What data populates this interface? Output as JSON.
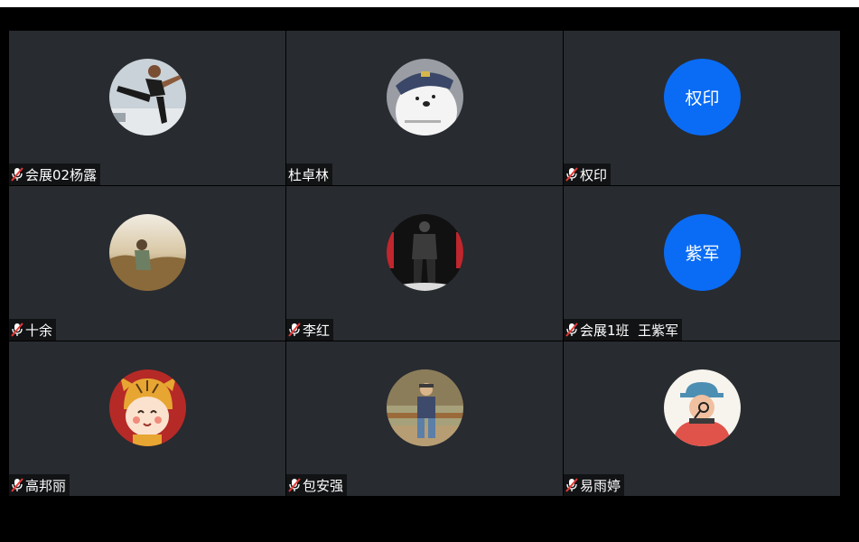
{
  "meeting": {
    "participants": [
      {
        "name": "会展02杨露",
        "muted": true,
        "avatar": "photo-dancer"
      },
      {
        "name": "杜卓林",
        "muted": false,
        "avatar": "photo-bear"
      },
      {
        "name": "权印",
        "muted": true,
        "avatar_text": "权印",
        "avatar_color": "#0a6cf5"
      },
      {
        "name": "十余",
        "muted": true,
        "avatar": "photo-field"
      },
      {
        "name": "李红",
        "muted": true,
        "avatar": "photo-player-24"
      },
      {
        "name": "会展1班  王紫军",
        "muted": true,
        "avatar_text": "紫军",
        "avatar_color": "#0a6cf5"
      },
      {
        "name": "高邦丽",
        "muted": true,
        "avatar": "cartoon-tiger-girl"
      },
      {
        "name": "包安强",
        "muted": true,
        "avatar": "photo-child"
      },
      {
        "name": "易雨婷",
        "muted": true,
        "avatar": "cartoon-detective"
      }
    ]
  },
  "colors": {
    "tile_bg": "#282b30",
    "avatar_blue": "#0a6cf5",
    "mute_red": "#e53935"
  }
}
